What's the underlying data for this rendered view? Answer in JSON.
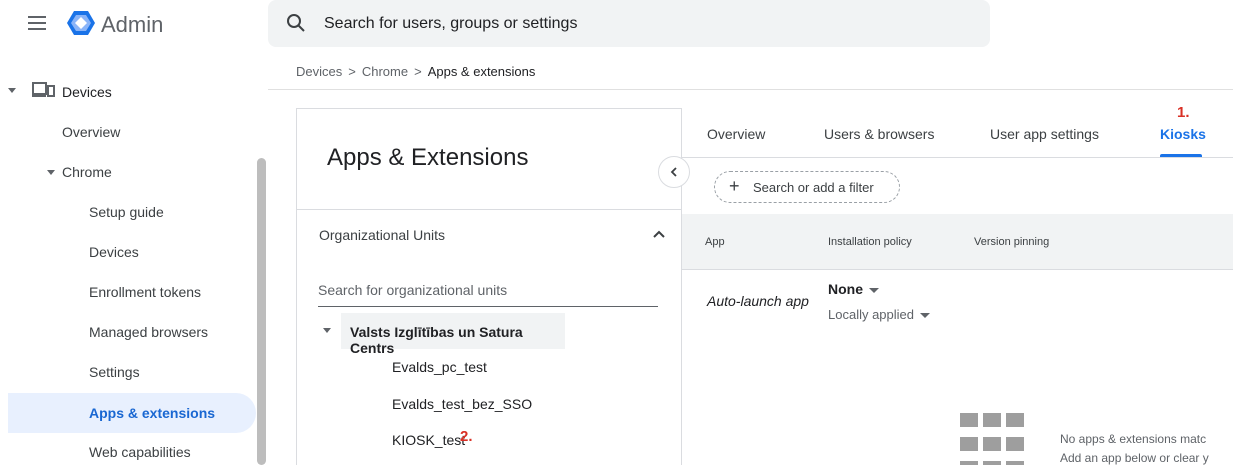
{
  "app": {
    "brand": "Admin",
    "accent": "#1a73e8",
    "annotation_color": "#d93025"
  },
  "search": {
    "placeholder": "Search for users, groups or settings"
  },
  "breadcrumb": {
    "items": [
      "Devices",
      "Chrome",
      "Apps & extensions"
    ],
    "separator": ">"
  },
  "sidebar": {
    "devices_label": "Devices",
    "items": [
      {
        "label": "Overview"
      },
      {
        "label": "Chrome"
      },
      {
        "label": "Setup guide"
      },
      {
        "label": "Devices"
      },
      {
        "label": "Enrollment tokens"
      },
      {
        "label": "Managed browsers"
      },
      {
        "label": "Settings"
      },
      {
        "label": "Apps & extensions",
        "active": true
      },
      {
        "label": "Web capabilities"
      }
    ]
  },
  "panel": {
    "title": "Apps & Extensions",
    "org_units_label": "Organizational Units",
    "ou_search_placeholder": "Search for organizational units",
    "root_unit": "Valsts Izglītības un Satura Centrs",
    "children": [
      "Evalds_pc_test",
      "Evalds_test_bez_SSO",
      "KIOSK_test"
    ]
  },
  "tabs": {
    "items": [
      "Overview",
      "Users & browsers",
      "User app settings",
      "Kiosks"
    ],
    "active": "Kiosks"
  },
  "annotations": {
    "one": "1.",
    "two": "2."
  },
  "filter": {
    "label": "Search or add a filter"
  },
  "table": {
    "headers": [
      "App",
      "Installation policy",
      "Version pinning"
    ],
    "row": {
      "app": "Auto-launch app",
      "policy": "None",
      "applied": "Locally applied"
    }
  },
  "empty_state": {
    "line1": "No apps & extensions matc",
    "line2": "Add an app below or clear y"
  }
}
